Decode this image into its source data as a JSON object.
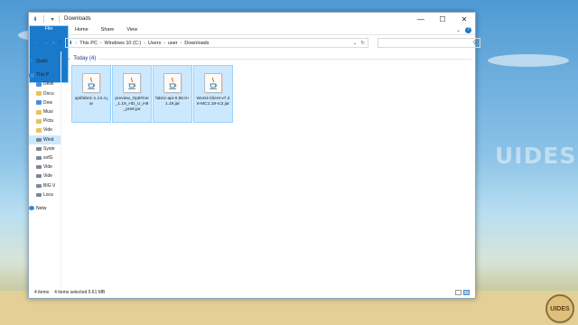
{
  "window": {
    "title": "Downloads",
    "controls": {
      "minimize": "—",
      "maximize": "☐",
      "close": "✕"
    }
  },
  "ribbon": {
    "tabs": [
      "File",
      "Home",
      "Share",
      "View"
    ],
    "collapse_glyph": "⌄",
    "help_glyph": "?"
  },
  "address": {
    "crumbs": [
      "This PC",
      "Windows 10 (C:)",
      "Users",
      "user",
      "Downloads"
    ],
    "search_placeholder": ""
  },
  "nav_pane": {
    "items": [
      {
        "label": "Quick",
        "icon": "star-icon",
        "selected": false
      },
      {
        "label": "This P",
        "icon": "pc-icon",
        "selected": false
      },
      {
        "label": "Desk",
        "icon": "folder-icon",
        "selected": false
      },
      {
        "label": "Docu",
        "icon": "folder-icon",
        "selected": false
      },
      {
        "label": "Dow",
        "icon": "download-icon",
        "selected": false
      },
      {
        "label": "Musi",
        "icon": "folder-icon",
        "selected": false
      },
      {
        "label": "Pictu",
        "icon": "folder-icon",
        "selected": false
      },
      {
        "label": "Vide",
        "icon": "folder-icon",
        "selected": false
      },
      {
        "label": "Wind",
        "icon": "drive-icon",
        "selected": true
      },
      {
        "label": "Syste",
        "icon": "drive-icon",
        "selected": false
      },
      {
        "label": "sofG",
        "icon": "drive-icon",
        "selected": false
      },
      {
        "label": "Vide",
        "icon": "drive-icon",
        "selected": false
      },
      {
        "label": "Vide",
        "icon": "drive-icon",
        "selected": false
      },
      {
        "label": "BIG V",
        "icon": "drive-icon",
        "selected": false
      },
      {
        "label": "Loca",
        "icon": "drive-icon",
        "selected": false
      },
      {
        "label": "Netw",
        "icon": "network-icon",
        "selected": false
      }
    ]
  },
  "content": {
    "group_label": "Today (4)",
    "files": [
      {
        "name": "optifabric-1.13.4.jar"
      },
      {
        "name": "preview_OptiFine_1.19_HD_U_H8_pre8.jar"
      },
      {
        "name": "fabric-api-0.56.0+1.19.jar"
      },
      {
        "name": "Wurst-Client-v7.26-MC1.19-rc2.jar"
      }
    ]
  },
  "status": {
    "count": "4 items",
    "selection": "4 items selected  9.61 MB"
  },
  "watermark": "UIDES",
  "corner_logo": "UIDES",
  "colors": {
    "accent": "#1979ca",
    "selection_bg": "#cce8ff",
    "selection_border": "#99d1ff"
  }
}
